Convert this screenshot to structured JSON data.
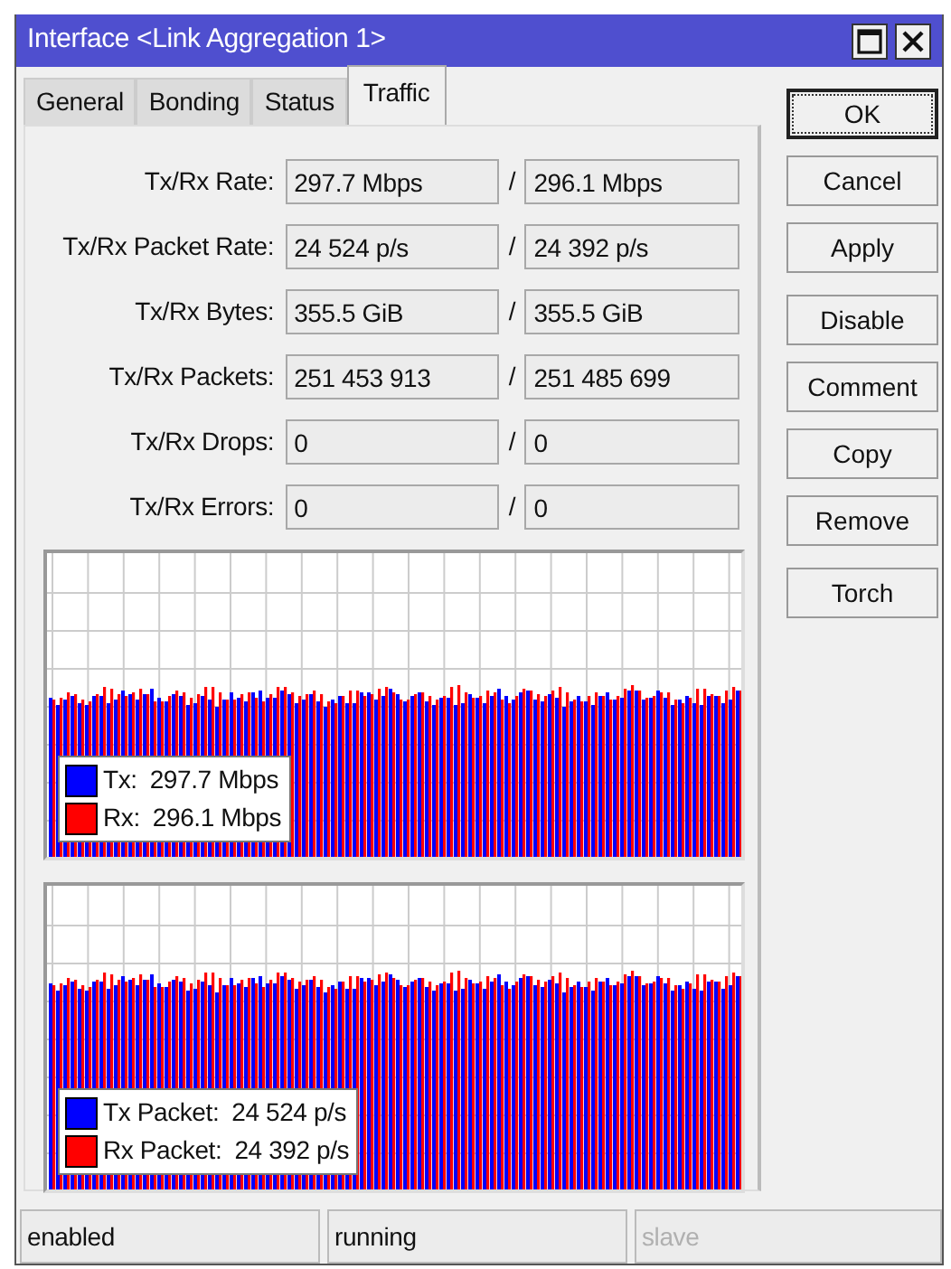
{
  "window": {
    "title": "Interface <Link Aggregation 1>"
  },
  "tabs": [
    {
      "label": "General",
      "selected": false
    },
    {
      "label": "Bonding",
      "selected": false
    },
    {
      "label": "Status",
      "selected": false
    },
    {
      "label": "Traffic",
      "selected": true
    }
  ],
  "fields": [
    {
      "label": "Tx/Rx Rate:",
      "tx": "297.7 Mbps",
      "separator": "/",
      "rx": "296.1 Mbps"
    },
    {
      "label": "Tx/Rx Packet Rate:",
      "tx": "24 524 p/s",
      "separator": "/",
      "rx": "24 392 p/s"
    },
    {
      "label": "Tx/Rx Bytes:",
      "tx": "355.5 GiB",
      "separator": "/",
      "rx": "355.5 GiB"
    },
    {
      "label": "Tx/Rx Packets:",
      "tx": "251 453 913",
      "separator": "/",
      "rx": "251 485 699"
    },
    {
      "label": "Tx/Rx Drops:",
      "tx": "0",
      "separator": "/",
      "rx": "0"
    },
    {
      "label": "Tx/Rx Errors:",
      "tx": "0",
      "separator": "/",
      "rx": "0"
    }
  ],
  "graphs": [
    {
      "legend": [
        {
          "label": "Tx:",
          "value": "297.7 Mbps",
          "color": "#0000ff"
        },
        {
          "label": "Rx:",
          "value": "296.1 Mbps",
          "color": "#ff0000"
        }
      ]
    },
    {
      "legend": [
        {
          "label": "Tx Packet:",
          "value": "24 524 p/s",
          "color": "#0000ff"
        },
        {
          "label": "Rx Packet:",
          "value": "24 392 p/s",
          "color": "#ff0000"
        }
      ]
    }
  ],
  "button_groups": [
    [
      {
        "label": "OK",
        "default": true
      },
      {
        "label": "Cancel",
        "default": false
      },
      {
        "label": "Apply",
        "default": false
      }
    ],
    [
      {
        "label": "Disable",
        "default": false
      },
      {
        "label": "Comment",
        "default": false
      },
      {
        "label": "Copy",
        "default": false
      },
      {
        "label": "Remove",
        "default": false
      }
    ],
    [
      {
        "label": "Torch",
        "default": false
      }
    ]
  ],
  "status_bar": [
    {
      "text": "enabled",
      "disabled": false
    },
    {
      "text": "running",
      "disabled": false
    },
    {
      "text": "slave",
      "disabled": true
    }
  ]
}
